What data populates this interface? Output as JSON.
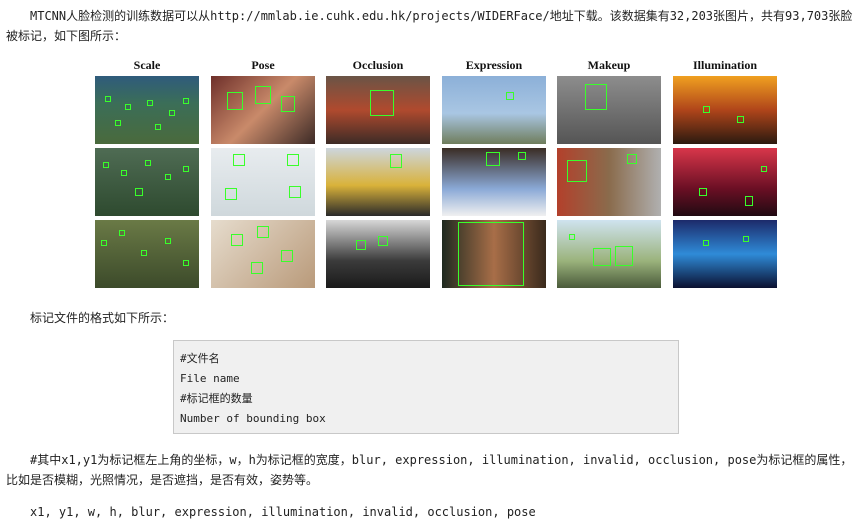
{
  "intro": {
    "text_before": "MTCNN人脸检测的训练数据可以从",
    "url": "http://mmlab.ie.cuhk.edu.hk/projects/WIDERFace/",
    "text_after": "地址下载。该数据集有32,203张图片，共有93,703张脸被标记，如下图所示："
  },
  "figure": {
    "columns": [
      "Scale",
      "Pose",
      "Occlusion",
      "Expression",
      "Makeup",
      "Illumination"
    ]
  },
  "format_intro": "标记文件的格式如下所示：",
  "code_lines": [
    "#文件名",
    "File name",
    "#标记框的数量",
    "Number of bounding box"
  ],
  "attr_desc": "#其中x1,y1为标记框左上角的坐标，w，h为标记框的宽度，blur, expression, illumination, invalid, occlusion, pose为标记框的属性，比如是否模糊，光照情况，是否遮挡，是否有效，姿势等。",
  "attr_list": "x1, y1, w, h, blur, expression, illumination, invalid, occlusion, pose"
}
